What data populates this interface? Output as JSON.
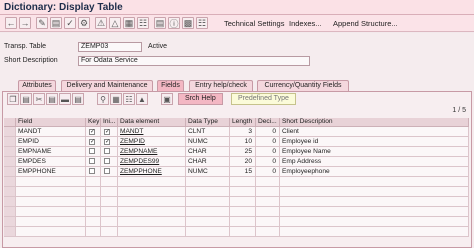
{
  "title": "Dictionary: Display Table",
  "toolbar": {
    "technical_settings": "Technical Settings",
    "indexes": "Indexes...",
    "append_structure": "Append Structure..."
  },
  "header": {
    "transp_label": "Transp. Table",
    "transp_value": "ZEMP03",
    "status": "Active",
    "short_desc_label": "Short Description",
    "short_desc_value": "For  Odata Service"
  },
  "tabs": [
    "Attributes",
    "Delivery and Maintenance",
    "Fields",
    "Entry help/check",
    "Currency/Quantity Fields"
  ],
  "active_tab": "Fields",
  "panel": {
    "srch_help": "Srch Help",
    "predefined_type": "Predefined Type",
    "pager": "1 / 5"
  },
  "columns": [
    "Field",
    "Key",
    "Ini...",
    "Data element",
    "Data Type",
    "Length",
    "Deci...",
    "Short Description"
  ],
  "rows": [
    {
      "field": "MANDT",
      "key": true,
      "init": true,
      "element": "MANDT",
      "type": "CLNT",
      "length": "3",
      "decimals": "0",
      "desc": "Client"
    },
    {
      "field": "EMPID",
      "key": true,
      "init": true,
      "element": "ZEMPID",
      "type": "NUMC",
      "length": "10",
      "decimals": "0",
      "desc": "Employee id"
    },
    {
      "field": "EMPNAME",
      "key": false,
      "init": false,
      "element": "ZEMPNAME",
      "type": "CHAR",
      "length": "25",
      "decimals": "0",
      "desc": "Employee Name"
    },
    {
      "field": "EMPDES",
      "key": false,
      "init": false,
      "element": "ZEMPDES99",
      "type": "CHAR",
      "length": "20",
      "decimals": "0",
      "desc": "Emp Address"
    },
    {
      "field": "EMPPHONE",
      "key": false,
      "init": false,
      "element": "ZEMPPHONE",
      "type": "NUMC",
      "length": "15",
      "decimals": "0",
      "desc": "Employeephone"
    }
  ],
  "colors": {
    "accent": "#f3b7c3",
    "title": "#1d2d4a"
  }
}
